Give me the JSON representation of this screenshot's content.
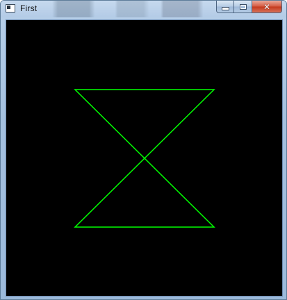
{
  "window": {
    "title": "First",
    "controls": {
      "minimize_icon": "minimize-icon",
      "maximize_icon": "maximize-icon",
      "close_icon": "close-icon"
    }
  },
  "canvas": {
    "background_color": "#000000",
    "stroke_color": "#00ff00",
    "shape": "bowtie"
  }
}
